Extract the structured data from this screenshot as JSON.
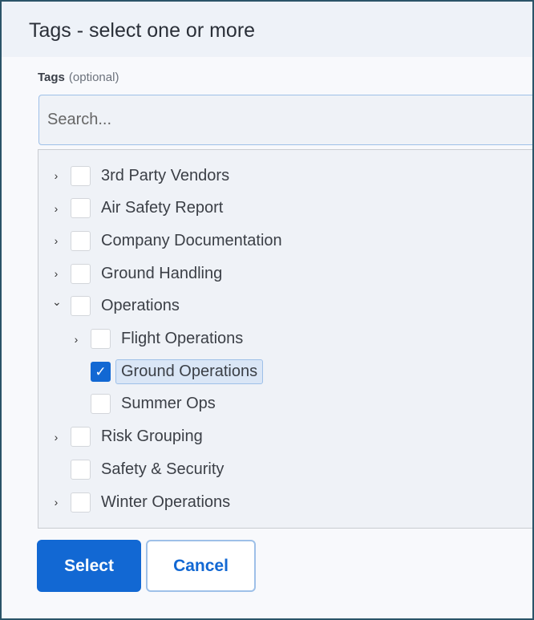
{
  "dialog": {
    "title": "Tags - select one or more"
  },
  "field": {
    "label": "Tags",
    "optional": "(optional)",
    "placeholder": "Search..."
  },
  "tree": [
    {
      "label": "3rd Party Vendors",
      "level": 0,
      "expander": "collapsed",
      "checked": false
    },
    {
      "label": "Air Safety Report",
      "level": 0,
      "expander": "collapsed",
      "checked": false
    },
    {
      "label": "Company Documentation",
      "level": 0,
      "expander": "collapsed",
      "checked": false
    },
    {
      "label": "Ground Handling",
      "level": 0,
      "expander": "collapsed",
      "checked": false
    },
    {
      "label": "Operations",
      "level": 0,
      "expander": "expanded",
      "checked": false
    },
    {
      "label": "Flight Operations",
      "level": 1,
      "expander": "collapsed",
      "checked": false
    },
    {
      "label": "Ground Operations",
      "level": 1,
      "expander": "none",
      "checked": true,
      "selected": true
    },
    {
      "label": "Summer Ops",
      "level": 1,
      "expander": "none",
      "checked": false
    },
    {
      "label": "Risk Grouping",
      "level": 0,
      "expander": "collapsed",
      "checked": false
    },
    {
      "label": "Safety & Security",
      "level": 0,
      "expander": "none",
      "checked": false
    },
    {
      "label": "Winter Operations",
      "level": 0,
      "expander": "collapsed",
      "checked": false
    }
  ],
  "buttons": {
    "select": "Select",
    "cancel": "Cancel"
  },
  "colors": {
    "accent": "#1268d3",
    "frame": "#2b5468"
  }
}
